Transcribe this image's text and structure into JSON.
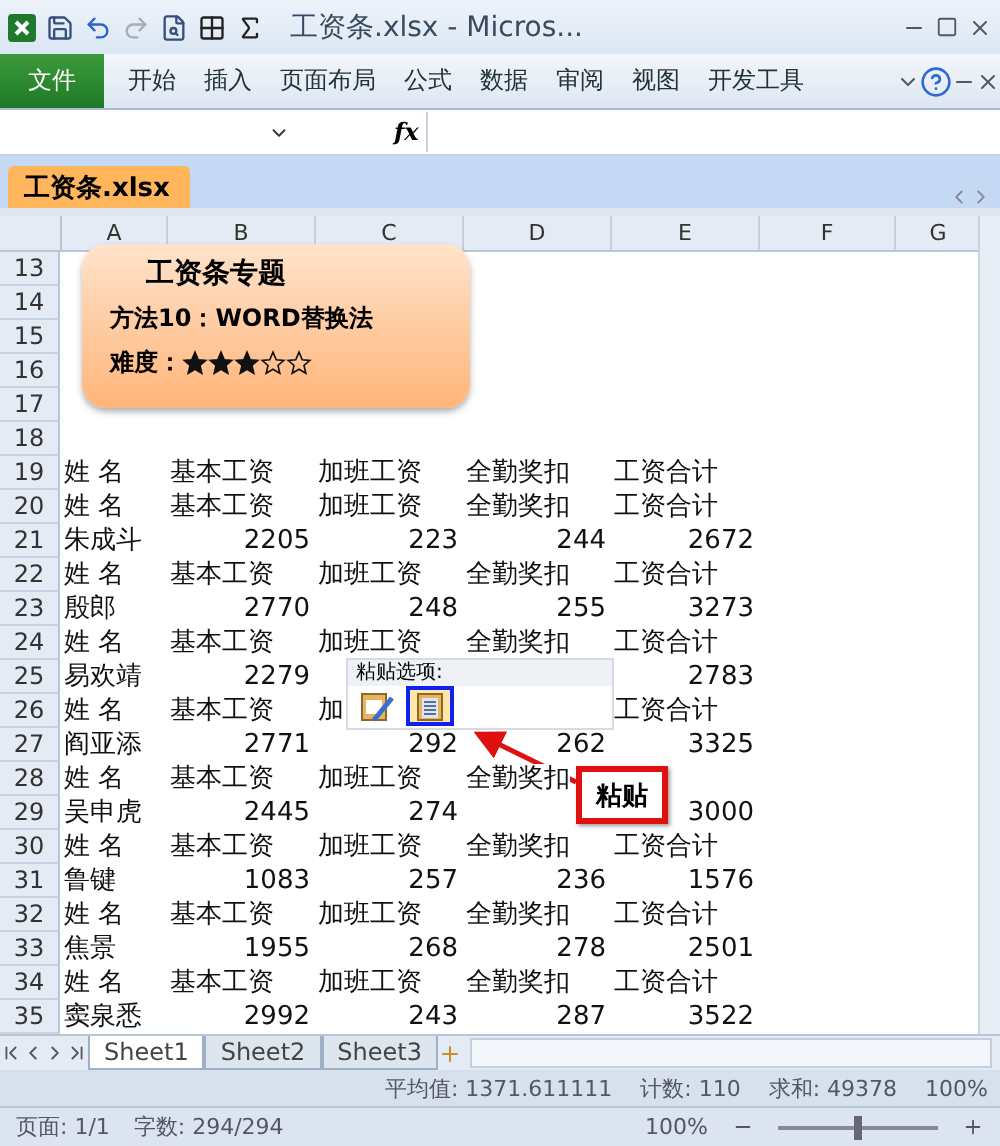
{
  "title_bar": {
    "title": "工资条.xlsx  -  Micros..."
  },
  "ribbon_tabs": [
    {
      "label": "文件",
      "selected": true
    },
    {
      "label": "开始",
      "selected": false
    },
    {
      "label": "插入",
      "selected": false
    },
    {
      "label": "页面布局",
      "selected": false
    },
    {
      "label": "公式",
      "selected": false
    },
    {
      "label": "数据",
      "selected": false
    },
    {
      "label": "审阅",
      "selected": false
    },
    {
      "label": "视图",
      "selected": false
    },
    {
      "label": "开发工具",
      "selected": false
    }
  ],
  "formula_bar": {
    "function_label": "fx"
  },
  "workbook_tab": "工资条.xlsx",
  "columns": [
    "A",
    "B",
    "C",
    "D",
    "E",
    "F",
    "G"
  ],
  "rows": [
    {
      "number": "13"
    },
    {
      "number": "14"
    },
    {
      "number": "15"
    },
    {
      "number": "16"
    },
    {
      "number": "17"
    },
    {
      "number": "18"
    },
    {
      "number": "19",
      "kind": "header",
      "cells": [
        "姓  名",
        "基本工资",
        "加班工资",
        "全勤奖扣",
        "工资合计"
      ]
    },
    {
      "number": "20",
      "kind": "header",
      "cells": [
        "姓  名",
        "基本工资",
        "加班工资",
        "全勤奖扣",
        "工资合计"
      ]
    },
    {
      "number": "21",
      "kind": "data",
      "cells": [
        "朱成斗",
        "2205",
        "223",
        "244",
        "2672"
      ]
    },
    {
      "number": "22",
      "kind": "header",
      "cells": [
        "姓  名",
        "基本工资",
        "加班工资",
        "全勤奖扣",
        "工资合计"
      ]
    },
    {
      "number": "23",
      "kind": "data",
      "cells": [
        "殷郎",
        "2770",
        "248",
        "255",
        "3273"
      ]
    },
    {
      "number": "24",
      "kind": "header",
      "cells": [
        "姓  名",
        "基本工资",
        "加班工资",
        "全勤奖扣",
        "工资合计"
      ]
    },
    {
      "number": "25",
      "kind": "data",
      "cells": [
        "易欢靖",
        "2279",
        null,
        null,
        "2783"
      ]
    },
    {
      "number": "26",
      "kind": "header",
      "cells": [
        "姓  名",
        "基本工资",
        "加",
        null,
        "工资合计"
      ]
    },
    {
      "number": "27",
      "kind": "data",
      "cells": [
        "阎亚添",
        "2771",
        "292",
        "262",
        "3325"
      ]
    },
    {
      "number": "28",
      "kind": "header",
      "cells": [
        "姓  名",
        "基本工资",
        "加班工资",
        "全勤奖扣",
        null
      ]
    },
    {
      "number": "29",
      "kind": "data",
      "cells": [
        "吴申虎",
        "2445",
        "274",
        null,
        "3000"
      ]
    },
    {
      "number": "30",
      "kind": "header",
      "cells": [
        "姓  名",
        "基本工资",
        "加班工资",
        "全勤奖扣",
        "工资合计"
      ]
    },
    {
      "number": "31",
      "kind": "data",
      "cells": [
        "鲁键",
        "1083",
        "257",
        "236",
        "1576"
      ]
    },
    {
      "number": "32",
      "kind": "header",
      "cells": [
        "姓  名",
        "基本工资",
        "加班工资",
        "全勤奖扣",
        "工资合计"
      ]
    },
    {
      "number": "33",
      "kind": "data",
      "cells": [
        "焦景",
        "1955",
        "268",
        "278",
        "2501"
      ]
    },
    {
      "number": "34",
      "kind": "header",
      "cells": [
        "姓  名",
        "基本工资",
        "加班工资",
        "全勤奖扣",
        "工资合计"
      ]
    },
    {
      "number": "35",
      "kind": "data",
      "cells": [
        "窦泉悉",
        "2992",
        "243",
        "287",
        "3522"
      ]
    }
  ],
  "shape": {
    "title": "工资条专题",
    "method": "方法10：WORD替换法",
    "difficulty_label": "难度：",
    "stars": 3
  },
  "paste_popup": {
    "title": "粘贴选项:",
    "options": [
      {
        "kind": "keep-format",
        "selected": false
      },
      {
        "kind": "text-only",
        "selected": true
      }
    ]
  },
  "callout": "粘贴",
  "sheet_tabs": [
    {
      "label": "Sheet1",
      "selected": true
    },
    {
      "label": "Sheet2",
      "selected": false
    },
    {
      "label": "Sheet3",
      "selected": false
    }
  ],
  "status": {
    "average": "平均值: 1371.611111",
    "count": "计数: 110",
    "sum": "求和: 49378",
    "zoom": "100%"
  },
  "word_status": {
    "page": "页面: 1/1",
    "words": "字数: 294/294",
    "zoom": "100%",
    "zoom_slider": {
      "level": 0.5
    }
  }
}
